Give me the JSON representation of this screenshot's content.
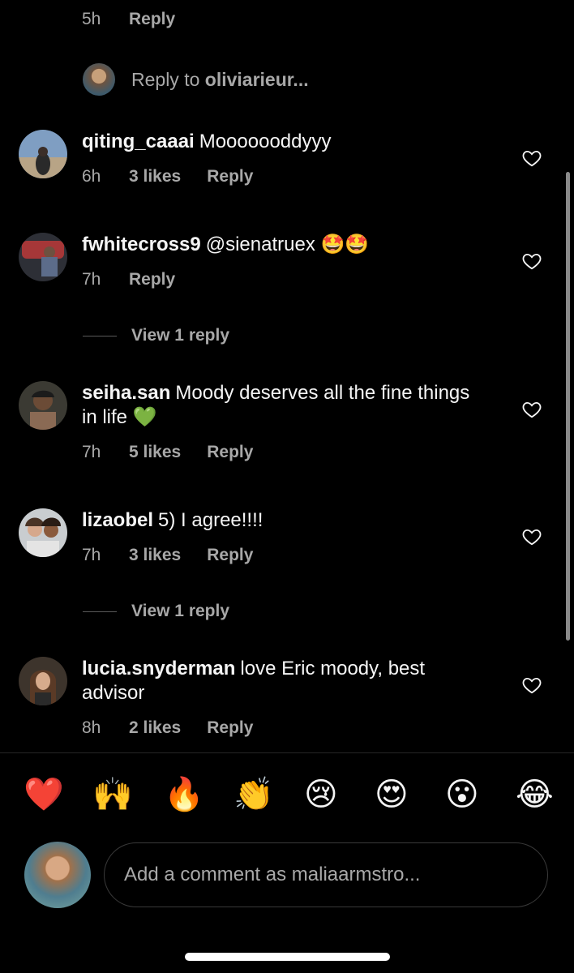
{
  "top_meta": {
    "time": "5h",
    "reply_label": "Reply"
  },
  "reply_to": {
    "prefix": "Reply to",
    "username": "oliviarieur..."
  },
  "comments": [
    {
      "username": "qiting_caaai",
      "text": "Mooooooddyyy",
      "time": "6h",
      "likes": "3 likes",
      "reply_label": "Reply"
    },
    {
      "username": "fwhitecross9",
      "text": "@sienatruex 🤩🤩",
      "time": "7h",
      "likes": "",
      "reply_label": "Reply"
    },
    {
      "username": "seiha.san",
      "text": "Moody deserves all the fine things in life 💚",
      "time": "7h",
      "likes": "5 likes",
      "reply_label": "Reply"
    },
    {
      "username": "lizaobel",
      "text": "5) I agree!!!!",
      "time": "7h",
      "likes": "3 likes",
      "reply_label": "Reply"
    },
    {
      "username": "lucia.snyderman",
      "text": "love Eric moody, best advisor",
      "time": "8h",
      "likes": "2 likes",
      "reply_label": "Reply"
    }
  ],
  "view_replies": [
    "View 1 reply",
    "View 1 reply"
  ],
  "emoji_bar": [
    "❤️",
    "🙌",
    "🔥",
    "👏",
    "😢",
    "😍",
    "😮",
    "😂"
  ],
  "composer": {
    "placeholder": "Add a comment as maliaarmstro..."
  },
  "icons": {
    "like": "heart-outline-icon"
  },
  "colors": {
    "background": "#000000",
    "primary_text": "#f5f5f5",
    "secondary_text": "#a8a8a8"
  }
}
